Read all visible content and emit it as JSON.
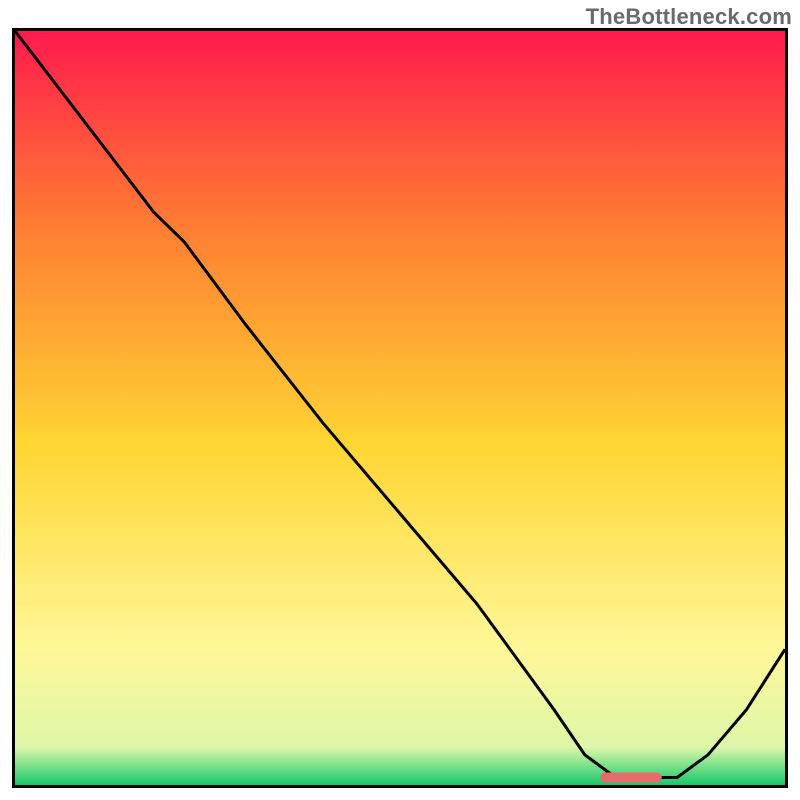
{
  "watermark": "TheBottleneck.com",
  "colors": {
    "frame": "#000000",
    "watermarkText": "#6a6a6a",
    "gradient_top": "#ff1a4d",
    "gradient_mid1": "#ff7a33",
    "gradient_mid2": "#ffd633",
    "gradient_low": "#fff799",
    "gradient_base": "#17c96c",
    "line": "#000000",
    "marker": "#e86a6a"
  },
  "chart_data": {
    "type": "line",
    "title": "",
    "xlabel": "",
    "ylabel": "",
    "xlim": [
      0,
      100
    ],
    "ylim": [
      0,
      100
    ],
    "grid": false,
    "legend": false,
    "series": [
      {
        "name": "bottleneck-curve",
        "x": [
          0,
          18,
          22,
          30,
          40,
          50,
          60,
          70,
          74,
          78,
          82,
          86,
          90,
          95,
          100
        ],
        "y": [
          100,
          76,
          72,
          61,
          48,
          36,
          24,
          10,
          4,
          1,
          1,
          1,
          4,
          10,
          18
        ]
      }
    ],
    "marker": {
      "name": "optimal-zone",
      "x_start": 76,
      "x_end": 84,
      "y": 1
    },
    "gradient_stops": [
      {
        "offset": 0.0,
        "color": "#ff1a4d"
      },
      {
        "offset": 0.25,
        "color": "#ff7a33"
      },
      {
        "offset": 0.55,
        "color": "#ffd633"
      },
      {
        "offset": 0.82,
        "color": "#fff799"
      },
      {
        "offset": 0.95,
        "color": "#ddf7a8"
      },
      {
        "offset": 1.0,
        "color": "#17c96c"
      }
    ]
  }
}
